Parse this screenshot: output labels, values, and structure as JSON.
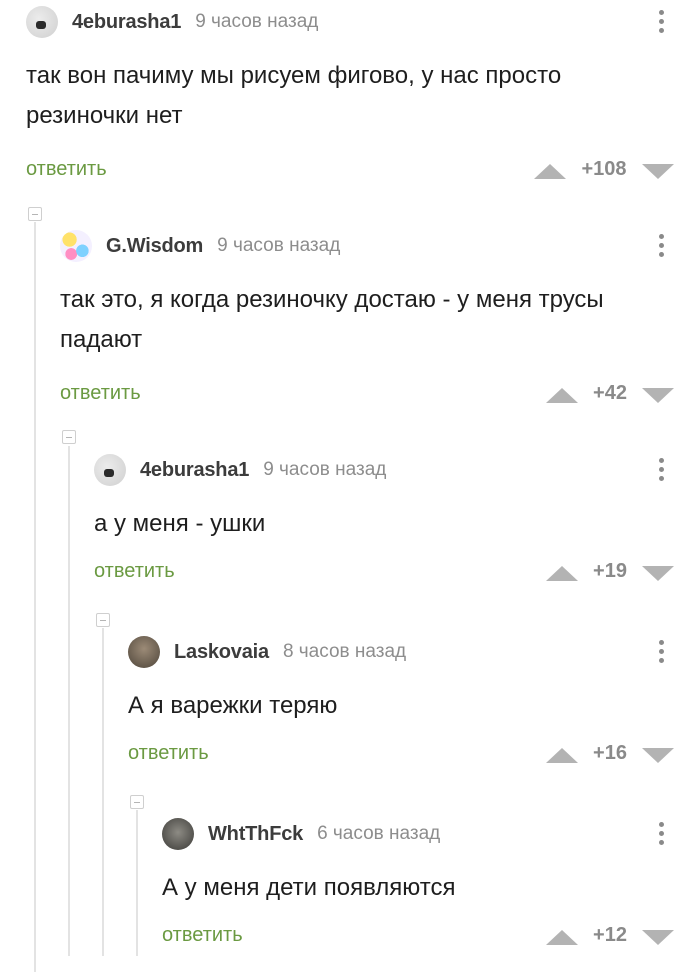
{
  "reply_label": "ответить",
  "comments": [
    {
      "author": "4eburasha1",
      "time": "9 часов назад",
      "text": "так вон пачиму мы рисуем фигово, у нас просто резиночки нет",
      "rating": "+108",
      "avatar": "cheburashka-avatar"
    },
    {
      "author": "G.Wisdom",
      "time": "9 часов назад",
      "text": "так это, я когда резиночку достаю - у меня трусы падают",
      "rating": "+42",
      "avatar": "colorful-cat-avatar"
    },
    {
      "author": "4eburasha1",
      "time": "9 часов назад",
      "text": "а у меня - ушки",
      "rating": "+19",
      "avatar": "cheburashka-avatar"
    },
    {
      "author": "Laskovaia",
      "time": "8 часов назад",
      "text": "А я варежки теряю",
      "rating": "+16",
      "avatar": "photo-avatar"
    },
    {
      "author": "WhtThFck",
      "time": "6 часов назад",
      "text": "А у меня дети появляются",
      "rating": "+12",
      "avatar": "photo-avatar"
    }
  ],
  "colors": {
    "reply_link": "#6b9a42",
    "vote_arrow": "#b3b3b3",
    "thread_line": "#e3e3e3"
  }
}
